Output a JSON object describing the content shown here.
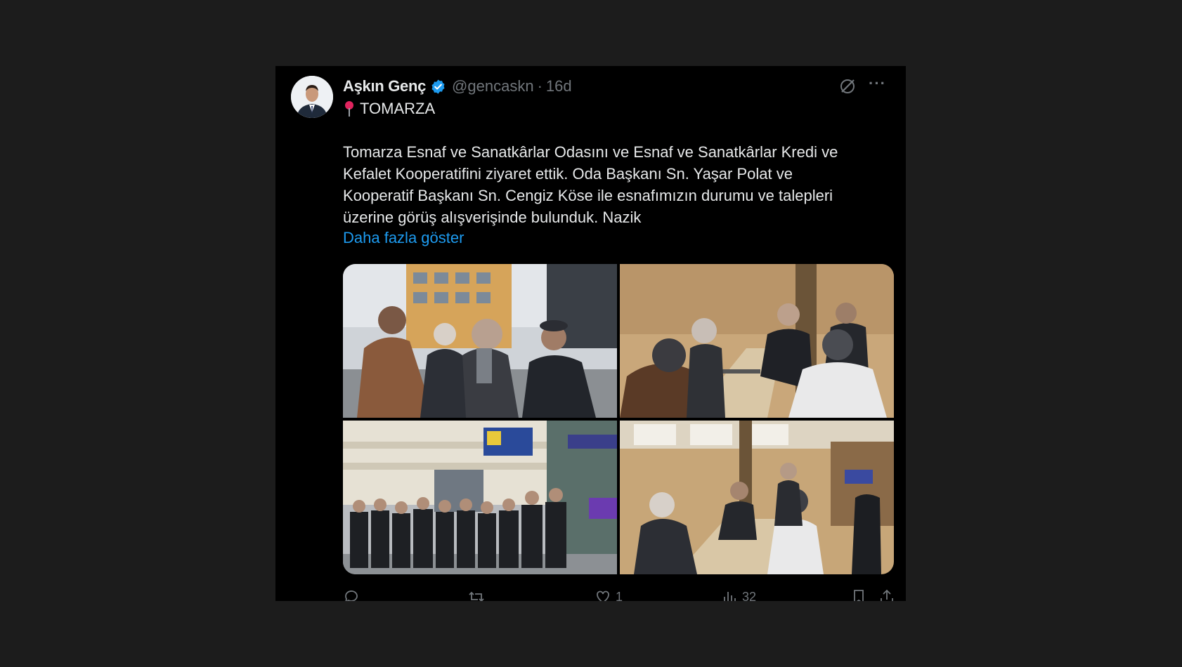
{
  "tweet": {
    "author_name": "Aşkın Genç",
    "handle": "@gencaskn",
    "separator": "·",
    "time": "16d",
    "location": "TOMARZA",
    "text": "Tomarza Esnaf ve Sanatkârlar Odasını ve Esnaf ve Sanatkârlar Kredi ve Kefalet Kooperatifini ziyaret ettik. Oda Başkanı Sn. Yaşar Polat ve Kooperatif Başkanı Sn. Cengiz Köse ile esnafımızın durumu ve talepleri üzerine görüş alışverişinde bulunduk. Nazik",
    "show_more": "Daha fazla göster",
    "more_menu": "···",
    "stats": {
      "likes": "1",
      "views": "32"
    }
  },
  "icons": {
    "verified": "verified-badge-icon",
    "grok": "grok-icon",
    "more": "more-icon",
    "pin": "pin-icon",
    "reply": "reply-icon",
    "retweet": "retweet-icon",
    "like": "heart-icon",
    "views": "views-icon",
    "bookmark": "bookmark-icon",
    "share": "share-icon"
  },
  "colors": {
    "background": "#1c1c1c",
    "card": "#000000",
    "text": "#e7e9ea",
    "muted": "#71767b",
    "link": "#1d9bf0",
    "verified": "#1d9bf0"
  }
}
